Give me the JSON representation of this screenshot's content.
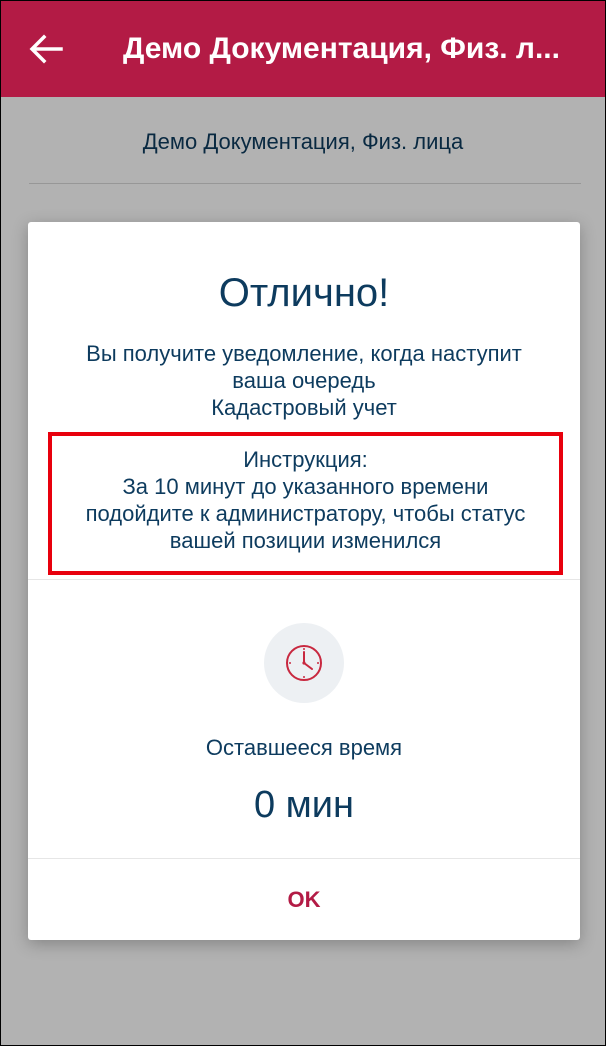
{
  "app_bar": {
    "title": "Демо Документация, Физ. л...",
    "back_icon": "arrow-left-icon",
    "color": "#b31b45"
  },
  "page": {
    "subtitle": "Демо Документация, Физ. лица"
  },
  "dialog": {
    "title": "Отлично!",
    "message_line1": "Вы получите уведомление, когда наступит",
    "message_line2": "ваша очередь",
    "message_line3": "Кадастровый учет",
    "instruction": {
      "heading": "Инструкция:",
      "line1": "За 10 минут до указанного времени",
      "line2": "подойдите к администратору, чтобы статус",
      "line3": "вашей позиции изменился",
      "highlight_color": "#e8000d"
    },
    "clock_icon": "clock-icon",
    "remaining_label": "Оставшееся время",
    "remaining_value": "0 мин",
    "ok_label": "OK"
  }
}
